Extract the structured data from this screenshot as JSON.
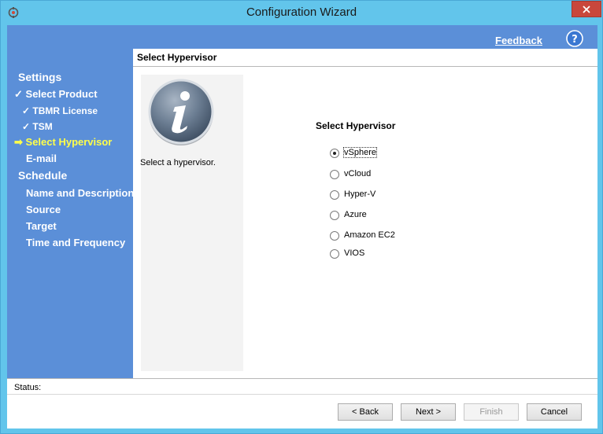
{
  "window": {
    "title": "Configuration Wizard"
  },
  "header": {
    "feedback_label": "Feedback"
  },
  "sidebar": {
    "items": [
      {
        "label": "Settings"
      },
      {
        "label": "Select Product"
      },
      {
        "label": "TBMR License"
      },
      {
        "label": "TSM"
      },
      {
        "label": "Select Hypervisor"
      },
      {
        "label": "E-mail"
      },
      {
        "label": "Schedule"
      },
      {
        "label": "Name and Description"
      },
      {
        "label": "Source"
      },
      {
        "label": "Target"
      },
      {
        "label": "Time and Frequency"
      }
    ],
    "check_mark": "✓",
    "current_arrow": "➡"
  },
  "page": {
    "header": "Select Hypervisor",
    "info_text": "Select a hypervisor.",
    "section_title": "Select Hypervisor",
    "options": [
      {
        "label": "vSphere",
        "selected": true
      },
      {
        "label": "vCloud",
        "selected": false
      },
      {
        "label": "Hyper-V",
        "selected": false
      },
      {
        "label": "Azure",
        "selected": false
      },
      {
        "label": "Amazon EC2",
        "selected": false
      },
      {
        "label": "VIOS",
        "selected": false
      }
    ]
  },
  "status": {
    "label": "Status:"
  },
  "buttons": {
    "back": "< Back",
    "next": "Next >",
    "finish": "Finish",
    "cancel": "Cancel"
  },
  "colors": {
    "window_frame": "#62c5eb",
    "sidebar": "#5b8fd8",
    "current_step": "#ffff4a",
    "close_button": "#c9473c"
  }
}
